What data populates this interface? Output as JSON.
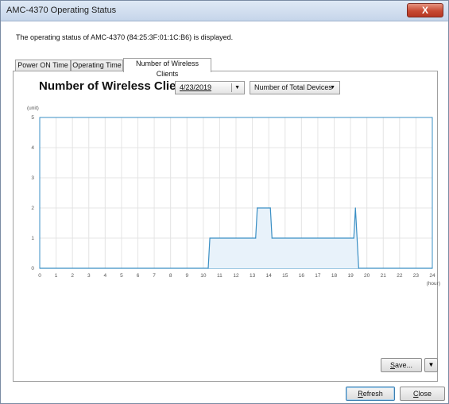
{
  "window": {
    "title": "AMC-4370 Operating Status",
    "close_glyph": "X"
  },
  "description": "The operating status of AMC-4370 (84:25:3F:01:1C:B6) is displayed.",
  "tabs": [
    {
      "label": "Power ON Time"
    },
    {
      "label": "Operating Time"
    },
    {
      "label": "Number of Wireless Clients"
    }
  ],
  "active_tab": "Number of Wireless Clients",
  "panel": {
    "heading": "Number of Wireless Clients",
    "date_select": {
      "value": "4/23/2019"
    },
    "type_select": {
      "value": "Number of Total Devices"
    }
  },
  "chart_data": {
    "type": "area",
    "ylabel": "(unit)",
    "xlabel": "(hour)",
    "xlim": [
      0,
      24
    ],
    "ylim": [
      0,
      5
    ],
    "xticks": [
      "0",
      "1",
      "2",
      "3",
      "4",
      "5",
      "6",
      "7",
      "8",
      "9",
      "10",
      "11",
      "12",
      "13",
      "14",
      "15",
      "16",
      "17",
      "18",
      "19",
      "20",
      "21",
      "22",
      "23",
      "24"
    ],
    "yticks": [
      "0",
      "1",
      "2",
      "3",
      "4",
      "5"
    ],
    "grid": true,
    "line_color": "#3a8fc4",
    "fill_color": "#e8f2fa",
    "series": [
      {
        "x": [
          0,
          10.3,
          10.4,
          13.2,
          13.3,
          14.1,
          14.2,
          19.2,
          19.3,
          19.5,
          24
        ],
        "values": [
          0,
          0,
          1,
          1,
          2,
          2,
          1,
          1,
          2,
          0,
          0
        ]
      }
    ]
  },
  "buttons": {
    "save": {
      "label_prefix": "S",
      "label_rest": "ave..."
    },
    "save_dropdown_glyph": "▼",
    "refresh": {
      "label_prefix": "R",
      "label_rest": "efresh"
    },
    "close": {
      "label_prefix": "C",
      "label_rest": "lose"
    }
  },
  "dropdown_glyph": "▼"
}
